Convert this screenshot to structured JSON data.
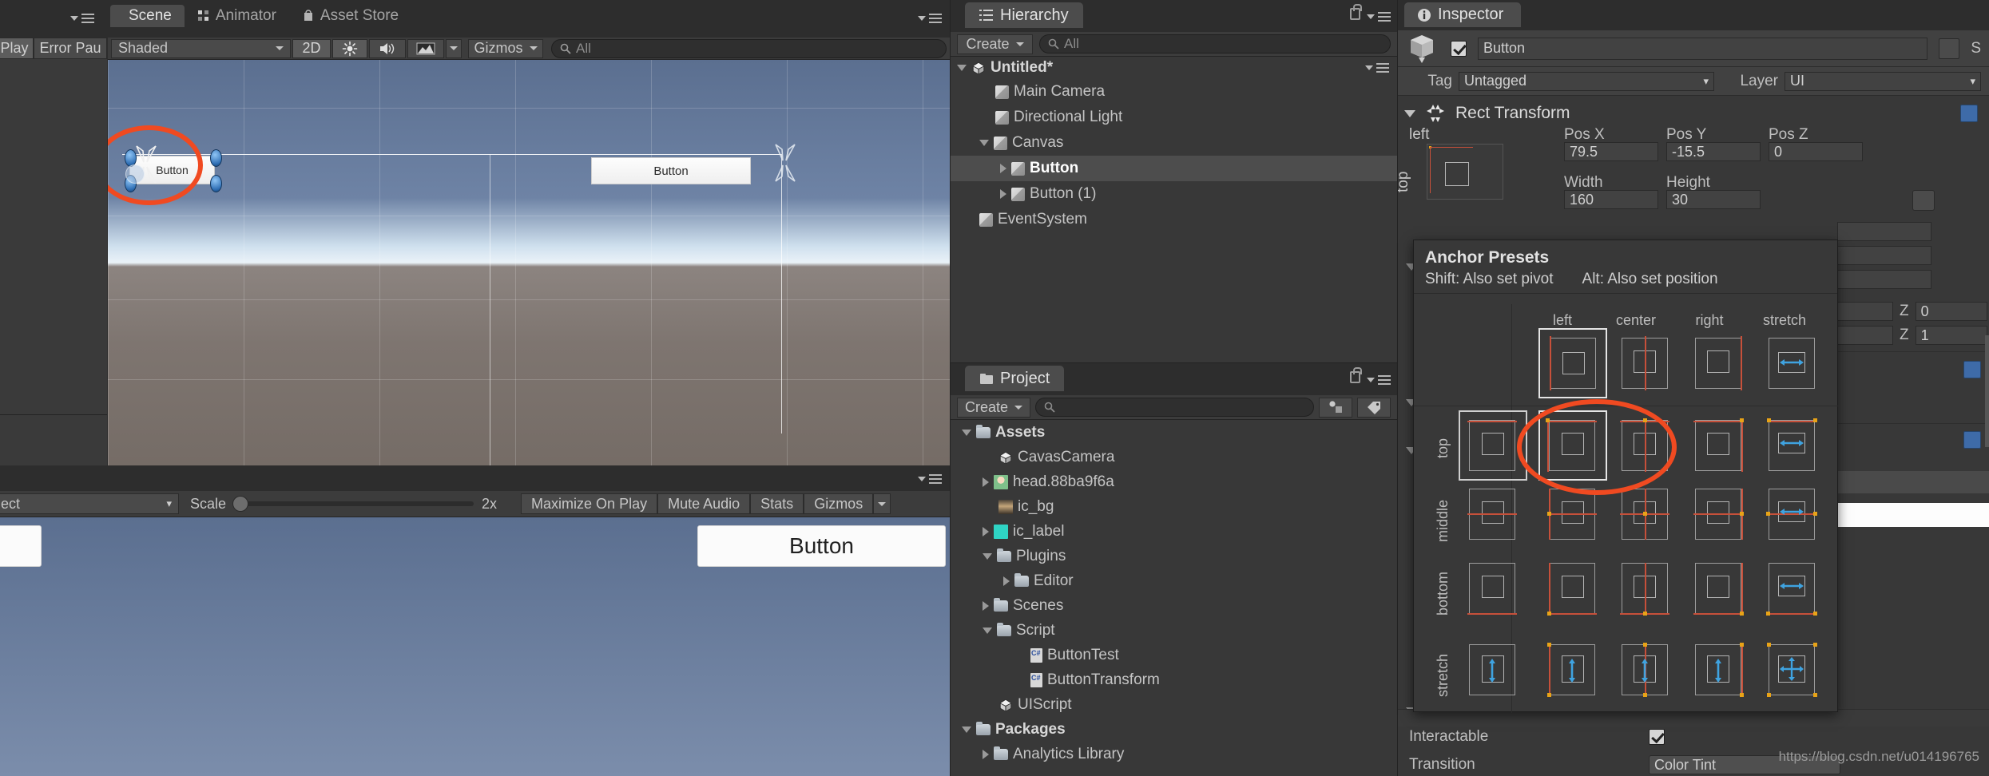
{
  "app": "Unity Editor",
  "scene_panel": {
    "tabs": [
      {
        "label": "Scene",
        "icon": "scene-icon",
        "active": true
      },
      {
        "label": "Animator",
        "icon": "animator-icon",
        "active": false
      },
      {
        "label": "Asset Store",
        "icon": "asset-store-icon",
        "active": false
      }
    ],
    "toolbar": {
      "shading_mode": "Shaded",
      "twod_toggle": "2D",
      "lighting_icon": "sun-icon",
      "audio_icon": "speaker-icon",
      "fx_icon": "image-effects-icon",
      "gizmos": "Gizmos",
      "search_placeholder": "All"
    },
    "scene_objects": [
      {
        "label": "Button",
        "name": "scene-button-selected"
      },
      {
        "label": "Button",
        "name": "scene-button-second"
      }
    ]
  },
  "top_left_toolbar": {
    "play_label": "Play",
    "error_pause_label": "Error Pau"
  },
  "game_panel": {
    "aspect_label": "ect",
    "scale_label": "Scale",
    "scale_value": "2x",
    "maximize_on_play": "Maximize On Play",
    "mute_audio": "Mute Audio",
    "stats": "Stats",
    "gizmos": "Gizmos",
    "game_button_label": "Button"
  },
  "hierarchy": {
    "tab_label": "Hierarchy",
    "create_label": "Create",
    "search_placeholder": "All",
    "lock_icon": "lock-icon",
    "menu_icon": "hamburger-menu-icon",
    "items": [
      {
        "label": "Untitled*",
        "depth": 0,
        "icon": "unity-scene-icon",
        "expanded": true,
        "selected": false,
        "bold": true
      },
      {
        "label": "Main Camera",
        "depth": 1,
        "icon": "gameobject-icon",
        "expanded": null,
        "selected": false
      },
      {
        "label": "Directional Light",
        "depth": 1,
        "icon": "gameobject-icon",
        "expanded": null,
        "selected": false
      },
      {
        "label": "Canvas",
        "depth": 1,
        "icon": "gameobject-icon",
        "expanded": true,
        "selected": false
      },
      {
        "label": "Button",
        "depth": 2,
        "icon": "gameobject-icon",
        "expanded": false,
        "selected": true
      },
      {
        "label": "Button (1)",
        "depth": 2,
        "icon": "gameobject-icon",
        "expanded": false,
        "selected": false
      },
      {
        "label": "EventSystem",
        "depth": 1,
        "icon": "gameobject-icon",
        "expanded": null,
        "selected": false
      }
    ]
  },
  "project": {
    "tab_label": "Project",
    "create_label": "Create",
    "search_placeholder": "",
    "lock_icon": "lock-icon",
    "menu_icon": "hamburger-menu-icon",
    "favorites_icon": "favorites-icon",
    "label_icon": "tag-icon",
    "items": [
      {
        "label": "Assets",
        "depth": 0,
        "icon": "folder-icon",
        "expanded": true,
        "bold": true
      },
      {
        "label": "CavasCamera",
        "depth": 1,
        "icon": "unity-prefab-icon",
        "expanded": null
      },
      {
        "label": "head.88ba9f6a",
        "depth": 1,
        "icon": "texture-head-icon",
        "expanded": false
      },
      {
        "label": "ic_bg",
        "depth": 1,
        "icon": "texture-bg-icon",
        "expanded": null
      },
      {
        "label": "ic_label",
        "depth": 1,
        "icon": "texture-label-icon",
        "expanded": false
      },
      {
        "label": "Plugins",
        "depth": 1,
        "icon": "folder-icon",
        "expanded": true
      },
      {
        "label": "Editor",
        "depth": 2,
        "icon": "folder-icon",
        "expanded": false
      },
      {
        "label": "Scenes",
        "depth": 1,
        "icon": "folder-icon",
        "expanded": false
      },
      {
        "label": "Script",
        "depth": 1,
        "icon": "folder-icon",
        "expanded": true
      },
      {
        "label": "ButtonTest",
        "depth": 2,
        "icon": "csharp-script-icon",
        "expanded": null
      },
      {
        "label": "ButtonTransform",
        "depth": 2,
        "icon": "csharp-script-icon",
        "expanded": null
      },
      {
        "label": "UIScript",
        "depth": 1,
        "icon": "unity-scene-icon",
        "expanded": null
      },
      {
        "label": "Packages",
        "depth": 0,
        "icon": "folder-icon",
        "expanded": true,
        "bold": true
      },
      {
        "label": "Analytics Library",
        "depth": 1,
        "icon": "folder-icon",
        "expanded": false
      }
    ]
  },
  "inspector": {
    "tab_label": "Inspector",
    "tab_icon": "info-icon",
    "object_enabled": true,
    "object_name": "Button",
    "static_label": "S",
    "tag_label": "Tag",
    "tag_value": "Untagged",
    "layer_label": "Layer",
    "layer_value": "UI",
    "rect_transform": {
      "title": "Rect Transform",
      "anchor_summary_h": "left",
      "anchor_summary_v": "top",
      "fields": [
        {
          "label": "Pos X",
          "value": "79.5"
        },
        {
          "label": "Pos Y",
          "value": "-15.5"
        },
        {
          "label": "Pos Z",
          "value": "0"
        },
        {
          "label": "Width",
          "value": "160"
        },
        {
          "label": "Height",
          "value": "30"
        }
      ],
      "z_rows": [
        {
          "label": "Z",
          "value": "0"
        },
        {
          "label": "Z",
          "value": "1"
        }
      ]
    },
    "button_component": {
      "interactable_label": "Interactable",
      "interactable_checked": true,
      "transition_label": "Transition",
      "transition_value": "Color Tint"
    }
  },
  "anchor_presets": {
    "title": "Anchor Presets",
    "shift_hint": "Shift: Also set pivot",
    "alt_hint": "Alt: Also set position",
    "col_headers": [
      "left",
      "center",
      "right",
      "stretch"
    ],
    "row_headers": [
      "top",
      "middle",
      "bottom",
      "stretch"
    ],
    "selected_col": 0,
    "selected_row": 0,
    "highlighted_cell": {
      "row": "top",
      "col": "left"
    }
  },
  "annotations": {
    "highlight_color": "#f04a21",
    "circles": [
      "scene-pivot-circle",
      "anchor-preset-circle"
    ]
  },
  "watermark": "https://blog.csdn.net/u014196765"
}
